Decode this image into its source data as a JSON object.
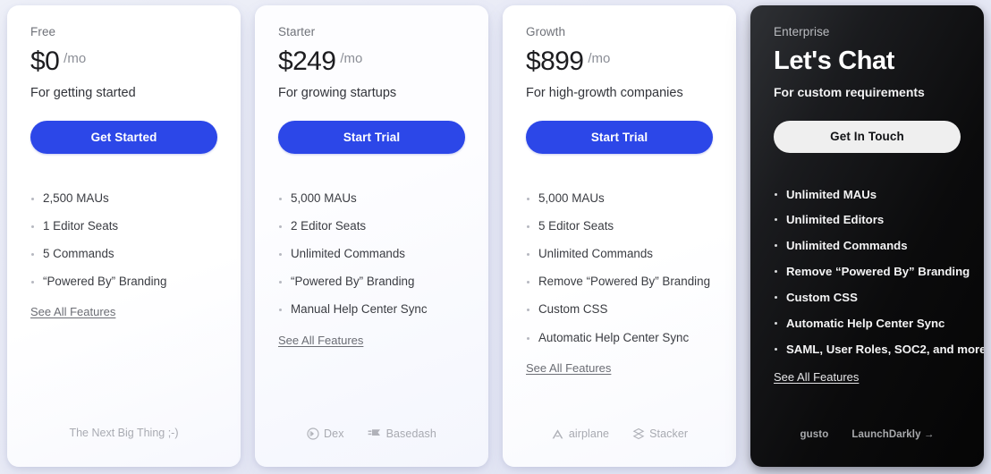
{
  "background_color": "#e9ebf6",
  "accent_color": "#2c47e8",
  "plans": [
    {
      "name": "Free",
      "price": "$0",
      "period": "/mo",
      "tagline": "For getting started",
      "cta_label": "Get Started",
      "features": [
        "2,500 MAUs",
        "1 Editor Seats",
        "5 Commands",
        "“Powered By” Branding"
      ],
      "see_all_label": "See All Features",
      "footer_note": "The Next Big Thing ;-)",
      "logos": []
    },
    {
      "name": "Starter",
      "price": "$249",
      "period": "/mo",
      "tagline": "For growing startups",
      "cta_label": "Start Trial",
      "features": [
        "5,000 MAUs",
        "2 Editor Seats",
        "Unlimited Commands",
        "“Powered By” Branding",
        "Manual Help Center Sync"
      ],
      "see_all_label": "See All Features",
      "footer_note": "",
      "logos": [
        {
          "name": "Dex",
          "icon": "dex-logo-icon"
        },
        {
          "name": "Basedash",
          "icon": "basedash-logo-icon"
        }
      ]
    },
    {
      "name": "Growth",
      "price": "$899",
      "period": "/mo",
      "tagline": "For high-growth companies",
      "cta_label": "Start Trial",
      "features": [
        "5,000 MAUs",
        "5 Editor Seats",
        "Unlimited Commands",
        "Remove “Powered By” Branding",
        "Custom CSS",
        "Automatic Help Center Sync"
      ],
      "see_all_label": "See All Features",
      "footer_note": "",
      "logos": [
        {
          "name": "airplane",
          "icon": "airplane-logo-icon"
        },
        {
          "name": "Stacker",
          "icon": "stacker-logo-icon"
        }
      ]
    },
    {
      "name": "Enterprise",
      "price": "Let's Chat",
      "period": "",
      "tagline": "For custom requirements",
      "cta_label": "Get In Touch",
      "features": [
        "Unlimited MAUs",
        "Unlimited Editors",
        "Unlimited Commands",
        "Remove “Powered By” Branding",
        "Custom CSS",
        "Automatic Help Center Sync",
        "SAML, User Roles, SOC2, and more"
      ],
      "see_all_label": "See All Features",
      "footer_note": "",
      "logos": [
        {
          "name": "gusto",
          "icon": "gusto-logo-icon"
        },
        {
          "name": "LaunchDarkly →",
          "icon": "launchdarkly-logo-icon"
        }
      ]
    }
  ]
}
